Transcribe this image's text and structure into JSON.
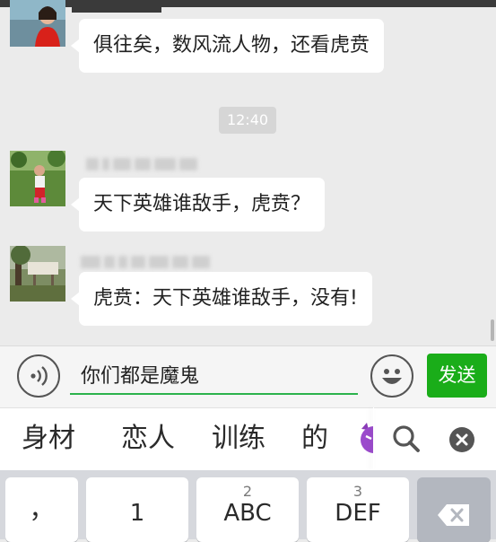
{
  "chat": {
    "messages": [
      {
        "text": "俱往矣，数风流人物，还看虎贲"
      },
      {
        "text": "天下英雄谁敌手，虎贲？"
      },
      {
        "text": "虎贲：天下英雄谁敌手，没有!"
      }
    ],
    "timestamp": "12:40"
  },
  "input": {
    "value": "你们都是魔鬼",
    "send_label": "发送",
    "voice_icon": "voice-icon",
    "emoji_icon": "emoji-icon"
  },
  "candidates": {
    "words": [
      "身材",
      "恋人",
      "训练",
      "的"
    ],
    "search_icon": "search-icon",
    "close_icon": "close-icon"
  },
  "keyboard": {
    "keys": [
      {
        "sub": "",
        "main": "，"
      },
      {
        "sub": "",
        "main": "1"
      },
      {
        "sub": "2",
        "main": "ABC"
      },
      {
        "sub": "3",
        "main": "DEF"
      }
    ],
    "delete_icon": "backspace-icon"
  },
  "colors": {
    "accent": "#1aad19",
    "chat_bg": "#ebebeb",
    "bubble": "#ffffff"
  }
}
